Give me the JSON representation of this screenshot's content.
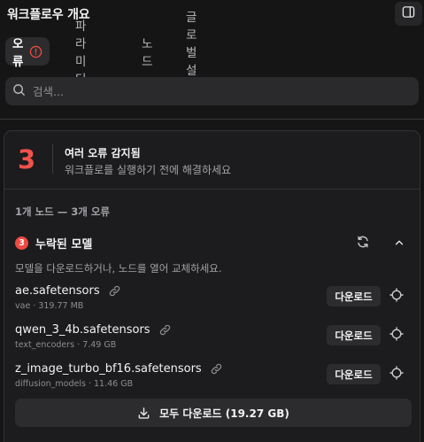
{
  "header": {
    "title": "워크플로우 개요"
  },
  "tabs": [
    {
      "label": "오류"
    },
    {
      "label": "파라미터"
    },
    {
      "label": "노드"
    },
    {
      "label": "글로벌 설정"
    }
  ],
  "search": {
    "placeholder": "검색..."
  },
  "summary": {
    "count": "3",
    "title": "여러 오류 감지됨",
    "subtitle": "워크플로를 실행하기 전에 해결하세요"
  },
  "stats": "1개 노드 — 3개 오류",
  "group": {
    "badge": "3",
    "title": "누락된 모델",
    "hint": "모델을 다운로드하거나, 노드를 열어 교체하세요.",
    "models": [
      {
        "name": "ae.safetensors",
        "meta": "vae · 319.77 MB",
        "button": "다운로드"
      },
      {
        "name": "qwen_3_4b.safetensors",
        "meta": "text_encoders · 7.49 GB",
        "button": "다운로드"
      },
      {
        "name": "z_image_turbo_bf16.safetensors",
        "meta": "diffusion_models · 11.46 GB",
        "button": "다운로드"
      }
    ],
    "download_all": "모두 다운로드 (19.27 GB)"
  },
  "colors": {
    "accent_error": "#ef4a42",
    "background": "#151516",
    "panel": "#1c1c1e"
  }
}
